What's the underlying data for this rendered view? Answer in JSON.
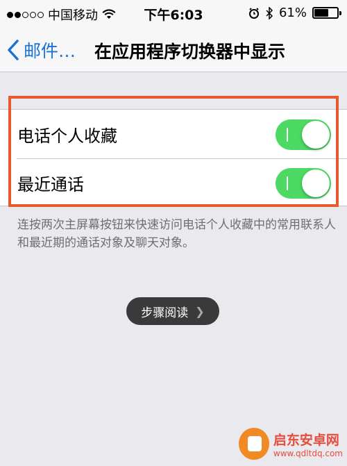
{
  "status_bar": {
    "carrier": "中国移动",
    "time": "下午6:03",
    "battery": "61%",
    "battery_level": 0.61,
    "signal": {
      "filled": 2,
      "total": 5
    },
    "icons": [
      "wifi-icon",
      "alarm-icon",
      "bluetooth-icon",
      "battery-icon"
    ]
  },
  "navbar": {
    "back_label": "邮件…",
    "title": "在应用程序切换器中显示"
  },
  "settings": {
    "rows": [
      {
        "label": "电话个人收藏",
        "enabled": true
      },
      {
        "label": "最近通话",
        "enabled": true
      }
    ],
    "footer": "连按两次主屏幕按钮来快速访问电话个人收藏中的常用联系人和最近期的通话对象及聊天对象。"
  },
  "overlay_button": {
    "label": "步骤阅读",
    "icon": "chevron-right-icon"
  },
  "watermark": {
    "name": "启东安卓网",
    "url": "www.qdltdq.com"
  },
  "colors": {
    "accent": "#1a73d4",
    "toggle_on": "#4cd964",
    "highlight": "#e65a2e",
    "background": "#e9e9ee"
  }
}
